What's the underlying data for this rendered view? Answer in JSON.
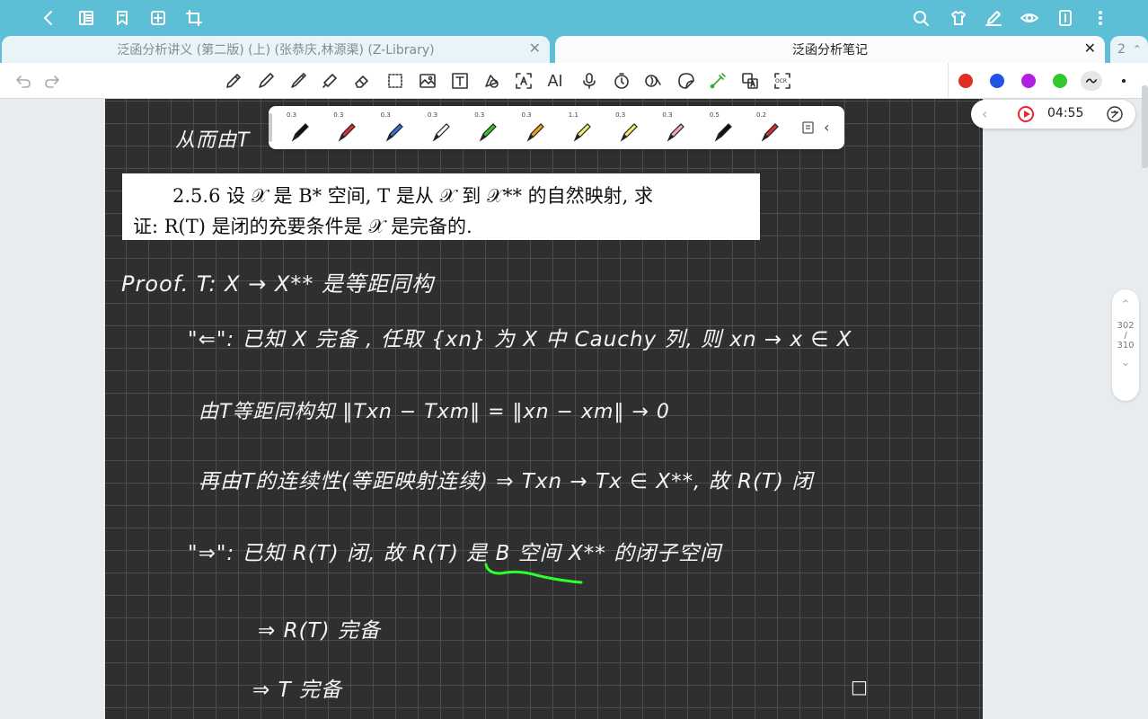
{
  "appbar": {
    "left_icons": [
      "back-icon",
      "book-icon",
      "bookmark-icon",
      "add-page-icon",
      "crop-icon"
    ],
    "right_icons": [
      "search-icon",
      "shirt-icon",
      "pen-settings-icon",
      "eye-icon",
      "book-view-icon",
      "more-icon"
    ]
  },
  "tabs": [
    {
      "label": "泛函分析讲义 (第二版) (上) (张恭庆,林源渠) (Z-Library)",
      "active": false
    },
    {
      "label": "泛函分析笔记",
      "active": true
    }
  ],
  "tab_count": "2",
  "tools": [
    "undo-icon",
    "redo-icon",
    "pencil-icon",
    "pen-icon",
    "marker-icon",
    "highlighter-icon",
    "eraser-icon",
    "lasso-icon",
    "image-icon",
    "text-icon",
    "shape-icon",
    "text-recognize-icon",
    "ai-icon",
    "mic-icon",
    "timer-icon",
    "pan-icon",
    "sticker-icon",
    "laser-icon",
    "translate-icon",
    "ocr-icon"
  ],
  "tool_text": {
    "ai": "AI",
    "ocr": "OCR"
  },
  "colors": [
    "#e02e24",
    "#1e55e6",
    "#b020e0",
    "#32c832"
  ],
  "pens": [
    {
      "w": "0.3",
      "color": "#111111"
    },
    {
      "w": "0.3",
      "color": "#d83030"
    },
    {
      "w": "0.3",
      "color": "#2f6fd8"
    },
    {
      "w": "0.3",
      "color": "#ffffff"
    },
    {
      "w": "0.3",
      "color": "#2ec82e"
    },
    {
      "w": "0.3",
      "color": "#f0a020"
    },
    {
      "w": "1.1",
      "color": "#f3ef6a"
    },
    {
      "w": "0.3",
      "color": "#f3ef6a"
    },
    {
      "w": "0.3",
      "color": "#f0a6d8"
    },
    {
      "w": "0.5",
      "color": "#111111"
    },
    {
      "w": "0.2",
      "color": "#d83030"
    }
  ],
  "recording": {
    "time": "04:55"
  },
  "pager": {
    "current": "302",
    "sep": "/",
    "total": "310"
  },
  "note": {
    "line0": "从而由T",
    "excerpt_line1": "2.5.6   设 𝒳 是 B* 空间, T 是从 𝒳 到 𝒳** 的自然映射, 求",
    "excerpt_line2": "证: R(T) 是闭的充要条件是 𝒳 是完备的.",
    "line1": "Proof.  T: X → X** 是等距同构",
    "line2": "\"⇐\": 已知 X 完备 , 任取 {xn} 为 X 中 Cauchy 列,  则 xn → x ∈ X",
    "line3": "由T等距同构知    ‖Txn − Txm‖ = ‖xn − xm‖ → 0",
    "line4": "再由T的连续性(等距映射连续) ⇒ Txn → Tx ∈ X**,  故 R(T) 闭",
    "line5": "\"⇒\":  已知 R(T) 闭,  故 R(T) 是 B 空间 X** 的闭子空间",
    "line6": "⇒ R(T) 完备",
    "line7": "⇒ T 完备",
    "qed": "□"
  }
}
